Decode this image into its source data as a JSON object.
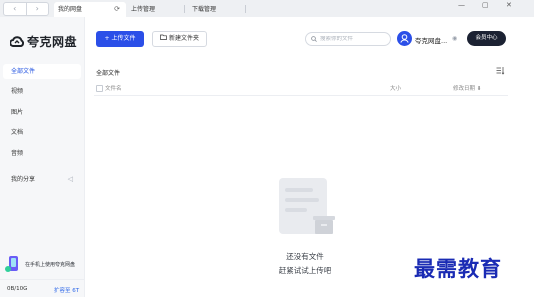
{
  "tabbar": {
    "nav_back": "‹",
    "nav_forward": "›",
    "tabs": [
      {
        "label": "我的网盘"
      },
      {
        "label": "上传管理"
      },
      {
        "label": "下载管理"
      }
    ],
    "refresh_glyph": "⟳",
    "win_minimize": "—",
    "win_maximize": "▢",
    "win_close": "✕"
  },
  "sidebar": {
    "logo_text": "夸克网盘",
    "items": [
      {
        "label": "全部文件"
      },
      {
        "label": "视频"
      },
      {
        "label": "图片"
      },
      {
        "label": "文档"
      },
      {
        "label": "音频"
      },
      {
        "label": "我的分享"
      }
    ],
    "promo_text": "在手机上使用夸克网盘",
    "storage_used": "0B/10G",
    "expand_label": "扩容至 6T"
  },
  "toolbar": {
    "upload_label": "+ 上传文件",
    "new_folder_label": "新建文件夹",
    "search_placeholder": "搜索你的文件",
    "username": "夸克网盘...",
    "member_label": "会员中心"
  },
  "list": {
    "breadcrumb": "全部文件",
    "columns": {
      "name": "文件名",
      "size": "大小",
      "date": "修改日期 ⬇"
    }
  },
  "empty": {
    "title": "还没有文件",
    "subtitle": "赶紧试试上传吧"
  },
  "watermark": "最需教育",
  "colors": {
    "accent": "#2b4fe8",
    "member_bg": "#1c2233",
    "watermark": "#1a2bb4"
  }
}
